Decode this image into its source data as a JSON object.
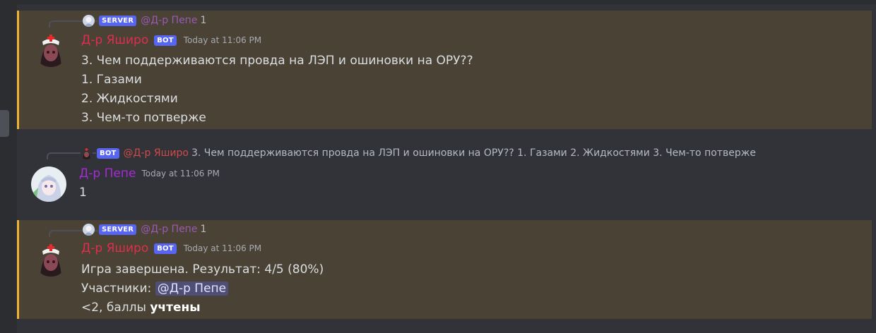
{
  "messages": [
    {
      "reply": {
        "tag": "SERVER",
        "mention": "@Д-р Пепе",
        "text": "1"
      },
      "author": "Д-р Яширо",
      "tag": "BOT",
      "timestamp": "Today at 11:06 PM",
      "lines": [
        "3. Чем поддерживаются провда на ЛЭП и ошиновки на ОРУ??",
        "1. Газами",
        "2. Жидкостями",
        "3. Чем-то потверже"
      ]
    },
    {
      "reply": {
        "tag": "BOT",
        "mention": "@Д-р Яширо",
        "text": "3. Чем поддерживаются провда на ЛЭП и ошиновки на ОРУ?? 1. Газами 2. Жидкостями 3. Чем-то потверже"
      },
      "author": "Д-р Пепе",
      "timestamp": "Today at 11:06 PM",
      "lines": [
        "1"
      ]
    },
    {
      "reply": {
        "tag": "SERVER",
        "mention": "@Д-р Пепе",
        "text": "1"
      },
      "author": "Д-р Яширо",
      "tag": "BOT",
      "timestamp": "Today at 11:06 PM",
      "line1": "Игра завершена. Результат: 4/5 (80%)",
      "line2_prefix": "Участники:",
      "line2_mention": "@Д-р Пепе",
      "line3_prefix": "<2,  баллы",
      "line3_bold": "учтены"
    }
  ],
  "colors": {
    "highlight_bg": "#4a4335",
    "highlight_border": "#f0b232",
    "bot_name": "#e02c50",
    "user_name": "#a62ad6",
    "tag_bg": "#5865f2"
  },
  "icons": {
    "bot_avatar": "nurse-girl-avatar",
    "user_avatar": "anime-girl-avatar"
  }
}
